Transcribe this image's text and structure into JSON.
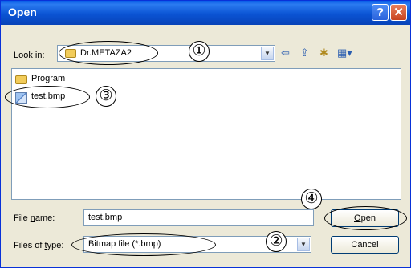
{
  "dialog": {
    "title": "Open",
    "help_glyph": "?",
    "close_glyph": "✕"
  },
  "lookin": {
    "label_pre": "Look ",
    "label_ul": "i",
    "label_post": "n:",
    "value": "Dr.METAZA2",
    "folder_icon": "folder-icon"
  },
  "toolbar": {
    "back_glyph": "⇦",
    "up_glyph": "⇪",
    "newfolder_glyph": "✱",
    "view_glyph": "▦▾"
  },
  "files": [
    {
      "name": "Program",
      "icon": "folder-icon"
    },
    {
      "name": "test.bmp",
      "icon": "bitmap-file-icon"
    }
  ],
  "filename": {
    "label_pre": "File ",
    "label_ul": "n",
    "label_post": "ame:",
    "value": "test.bmp"
  },
  "filetype": {
    "label_pre": "Files of ",
    "label_ul": "t",
    "label_post": "ype:",
    "value": "Bitmap file (*.bmp)"
  },
  "buttons": {
    "open_ul": "O",
    "open_rest": "pen",
    "cancel": "Cancel"
  },
  "callouts": [
    "①",
    "②",
    "③",
    "④"
  ]
}
